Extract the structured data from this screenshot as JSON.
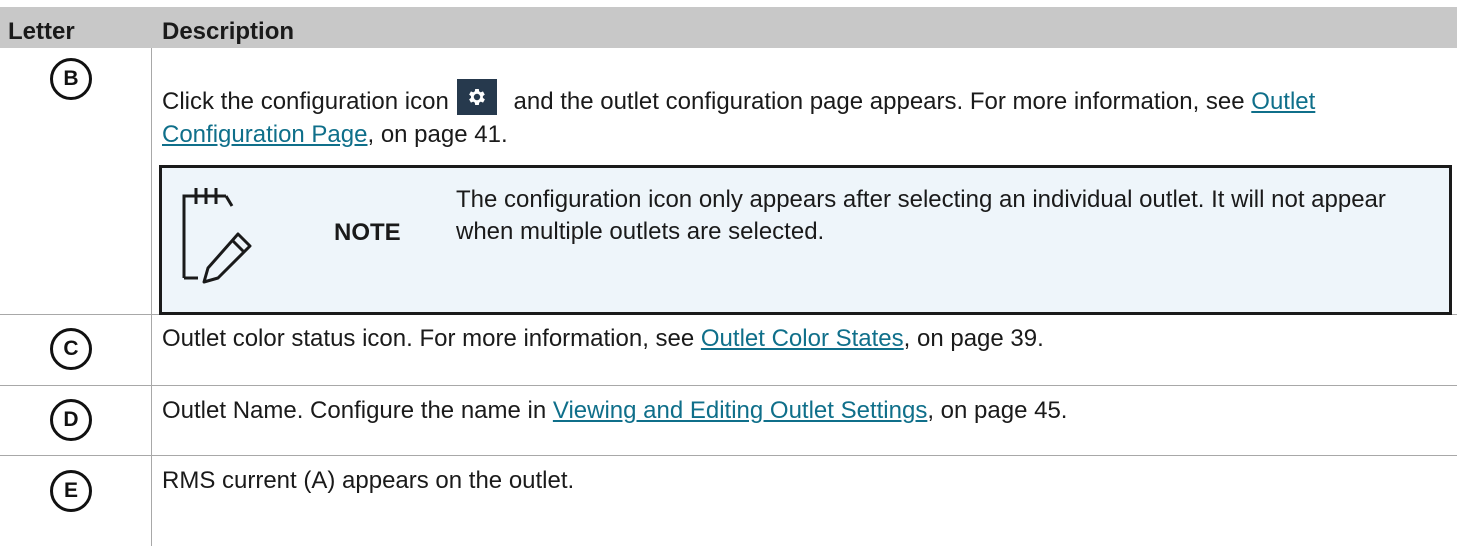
{
  "header": {
    "letter": "Letter",
    "description": "Description"
  },
  "rows": [
    {
      "letter": "B",
      "text_before_icon": "Click the configuration icon",
      "text_after_icon": " and the outlet configuration page appears. For more information, see ",
      "link": "Outlet Configuration Page",
      "text_after_link": ", on page 41."
    },
    {
      "letter": "C",
      "text_before_link": "Outlet color status icon. For more information, see ",
      "link": "Outlet Color States",
      "text_after_link": ", on page 39."
    },
    {
      "letter": "D",
      "text_before_link": "Outlet Name. Configure the name in ",
      "link": "Viewing and Editing Outlet Settings",
      "text_after_link": ", on page 45."
    },
    {
      "letter": "E",
      "text": "RMS current (A) appears on the outlet."
    }
  ],
  "note": {
    "label": "NOTE",
    "text": "The configuration icon only appears after selecting an individual outlet. It will not appear when multiple outlets are selected.",
    "icon": "notepad-pencil-icon"
  },
  "icons": {
    "config": "gear-icon"
  },
  "colors": {
    "header_bg": "#c8c8c8",
    "link": "#0f6f8a",
    "note_bg": "#eef5fa",
    "config_icon_bg": "#26394d"
  }
}
